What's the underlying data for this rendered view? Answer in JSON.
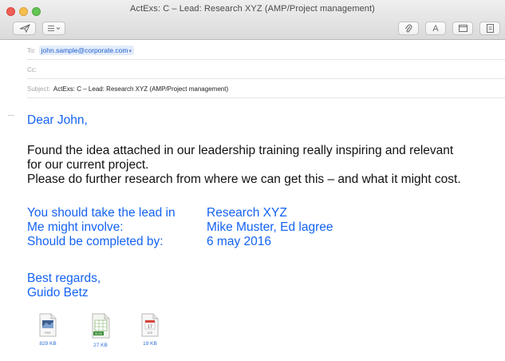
{
  "window": {
    "title": "ActExs: C – Lead: Research XYZ  (AMP/Project management)"
  },
  "toolbar": {
    "left_buttons": [
      "send-icon",
      "format-list-icon"
    ],
    "right_buttons": [
      "paperclip-icon",
      "font-icon",
      "photo-browser-icon",
      "attachment-panel-icon"
    ],
    "font_button_label": "A"
  },
  "header": {
    "to_label": "To:",
    "to_value": "john.sample@corporate.com",
    "cc_label": "Cc:",
    "subject_label": "Subject:",
    "subject_value": "ActExs: C – Lead: Research XYZ  (AMP/Project management)"
  },
  "body": {
    "greeting": "Dear John,",
    "paragraph": [
      "Found the idea attached  in our leadership training really inspiring and relevant",
      "for our current project.",
      "Please do further research from where we can get this – and what it might cost."
    ],
    "details": [
      {
        "key": "You should take the lead in",
        "value": "Research XYZ"
      },
      {
        "key": "Me might involve:",
        "value": "Mike Muster, Ed lagree"
      },
      {
        "key": "Should be completed by:",
        "value": "6 may 2016"
      }
    ],
    "closing": "Best regards,",
    "signature": "Guido Betz"
  },
  "attachments": [
    {
      "type": "pdf-icon",
      "label": "PDF",
      "size": "829 KB"
    },
    {
      "type": "spreadsheet-icon",
      "label": "XLSX",
      "size": "27 KB"
    },
    {
      "type": "calendar-ics-icon",
      "label": "ICS",
      "day": "17",
      "size": "19 KB"
    }
  ],
  "colors": {
    "body_accent": "#1463f3",
    "address_chip_bg": "#e3ecfa"
  }
}
